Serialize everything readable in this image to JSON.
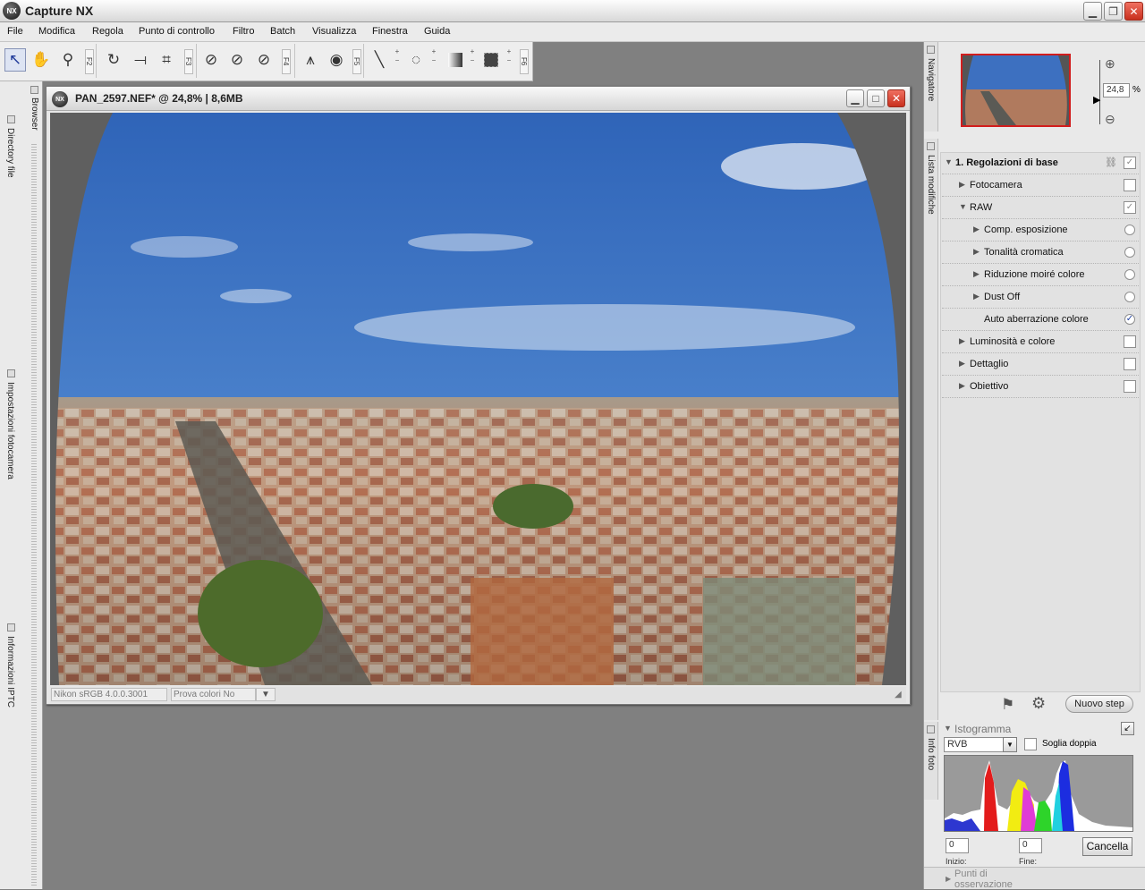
{
  "app": {
    "title": "Capture NX",
    "logo": "NX"
  },
  "menu": [
    "File",
    "Modifica",
    "Regola",
    "Punto di controllo",
    "Filtro",
    "Batch",
    "Visualizza",
    "Finestra",
    "Guida"
  ],
  "toolbar": {
    "fkeys": [
      "F2",
      "F3",
      "F4",
      "F5",
      "F6"
    ]
  },
  "left_tabs": [
    "Browser",
    "Directory file",
    "Impostazioni fotocamera",
    "Informazioni IPTC"
  ],
  "image_window": {
    "logo": "NX",
    "title": "PAN_2597.NEF* @ 24,8% | 8,6MB",
    "profile": "Nikon sRGB 4.0.0.3001",
    "proof": "Prova colori No"
  },
  "navigator": {
    "label": "Navigatore",
    "zoom": "24,8",
    "zoom_unit": "%"
  },
  "edit_list": {
    "label": "Lista modifiche",
    "step_title": "1.  Regolazioni di base",
    "rows": [
      {
        "label": "Fotocamera",
        "control": "checkbox",
        "checked": false
      },
      {
        "label": "RAW",
        "control": "checkbox",
        "checked": true
      },
      {
        "label": "Comp. esposizione",
        "control": "radio",
        "checked": false
      },
      {
        "label": "Tonalità cromatica",
        "control": "radio",
        "checked": false
      },
      {
        "label": "Riduzione moiré colore",
        "control": "radio",
        "checked": false
      },
      {
        "label": "Dust Off",
        "control": "radio",
        "checked": false
      },
      {
        "label": "Auto aberrazione colore",
        "control": "radio",
        "checked": true
      },
      {
        "label": "Luminosità e colore",
        "control": "checkbox",
        "checked": false
      },
      {
        "label": "Dettaglio",
        "control": "checkbox",
        "checked": false
      },
      {
        "label": "Obiettivo",
        "control": "checkbox",
        "checked": false
      }
    ],
    "new_step": "Nuovo step"
  },
  "photo_info": {
    "label": "Info foto",
    "histogram_title": "Istogramma",
    "channel": "RVB",
    "double_threshold": "Soglia doppia",
    "start_value": "0",
    "end_value": "0",
    "start_label": "Inizio:",
    "end_label": "Fine:",
    "cancel": "Cancella",
    "watch_points": "Punti di osservazione"
  }
}
